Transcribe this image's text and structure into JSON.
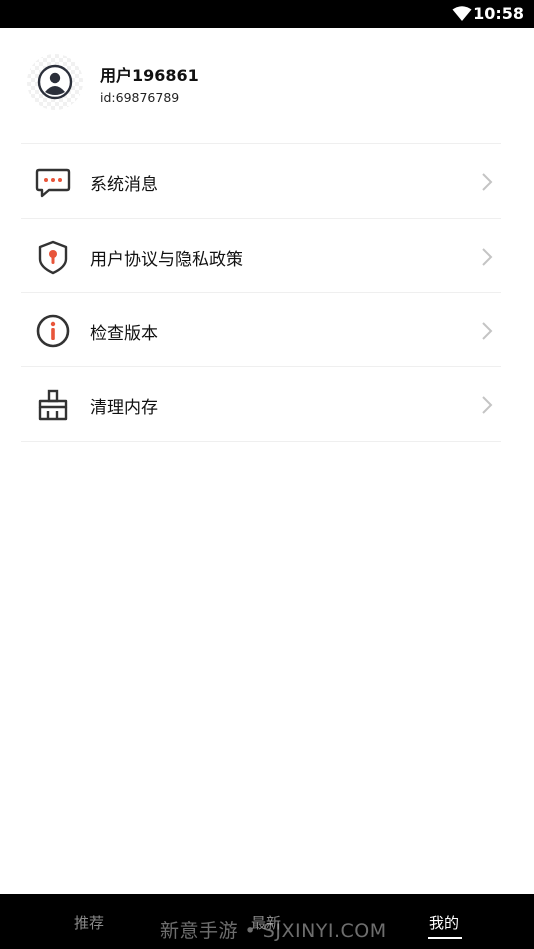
{
  "status_bar": {
    "time": "10:58"
  },
  "profile": {
    "username": "用户196861",
    "user_id": "id:69876789"
  },
  "menu": {
    "items": [
      {
        "label": "系统消息",
        "icon": "message-icon"
      },
      {
        "label": "用户协议与隐私政策",
        "icon": "shield-icon"
      },
      {
        "label": "检查版本",
        "icon": "info-icon"
      },
      {
        "label": "清理内存",
        "icon": "broom-icon"
      }
    ]
  },
  "bottom_nav": {
    "items": [
      {
        "label": "推荐"
      },
      {
        "label": "最新"
      },
      {
        "label": "我的"
      }
    ],
    "active_index": 2
  },
  "watermark": "新意手游 • SJXINYI.COM",
  "colors": {
    "accent": "#e8553a",
    "icon_dark": "#333333",
    "nav_bg": "#000000"
  }
}
